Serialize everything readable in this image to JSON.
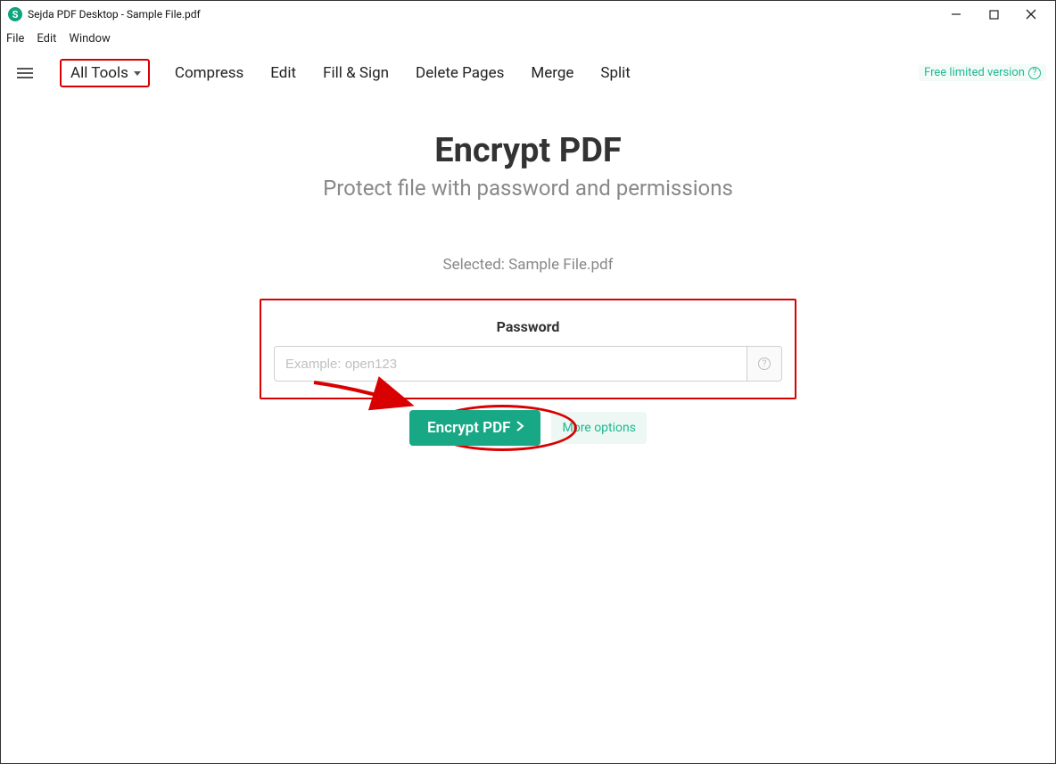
{
  "window": {
    "app_glyph": "S",
    "title": "Sejda PDF Desktop - Sample File.pdf"
  },
  "menubar": {
    "file": "File",
    "edit": "Edit",
    "window": "Window"
  },
  "toolbar": {
    "all_tools": "All Tools",
    "compress": "Compress",
    "edit": "Edit",
    "fill_sign": "Fill & Sign",
    "delete_pages": "Delete Pages",
    "merge": "Merge",
    "split": "Split",
    "version_label": "Free limited version"
  },
  "page": {
    "title": "Encrypt PDF",
    "subtitle": "Protect file with password and permissions",
    "selected_prefix": "Selected: Sample File.pdf"
  },
  "password": {
    "label": "Password",
    "placeholder": "Example: open123",
    "help_glyph": "?"
  },
  "actions": {
    "encrypt_label": "Encrypt PDF",
    "more_options": "More options"
  },
  "annotations": {
    "all_tools_highlight": true,
    "password_box_highlight": true,
    "encrypt_circle": true,
    "arrow": true
  }
}
